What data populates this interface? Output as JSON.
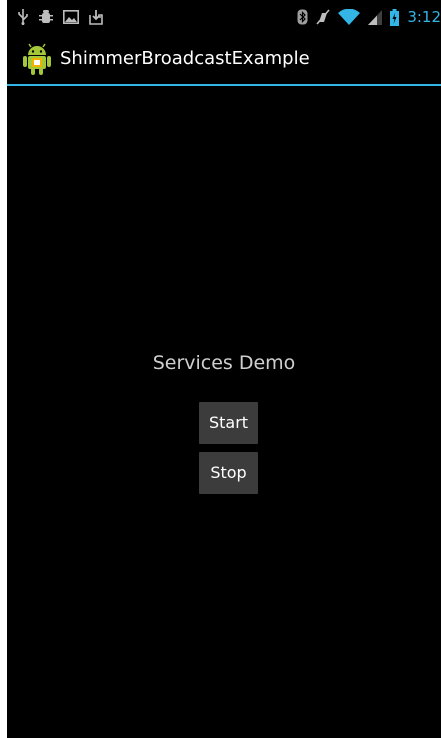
{
  "status_bar": {
    "time": "3:12",
    "left_icons": [
      "usb-icon",
      "debug-icon",
      "image-icon",
      "download-icon"
    ],
    "right_icons": [
      "bluetooth-icon",
      "mute-icon",
      "wifi-icon",
      "signal-icon",
      "battery-icon"
    ],
    "time_color": "#33b5e5"
  },
  "action_bar": {
    "title": "ShimmerBroadcastExample",
    "icon": "android-app-icon",
    "divider_color": "#33b5e5"
  },
  "main": {
    "heading": "Services Demo",
    "start_label": "Start",
    "stop_label": "Stop"
  },
  "colors": {
    "background": "#000000",
    "button": "#3c3c3c",
    "accent": "#33b5e5",
    "android_green": "#a4c639"
  }
}
